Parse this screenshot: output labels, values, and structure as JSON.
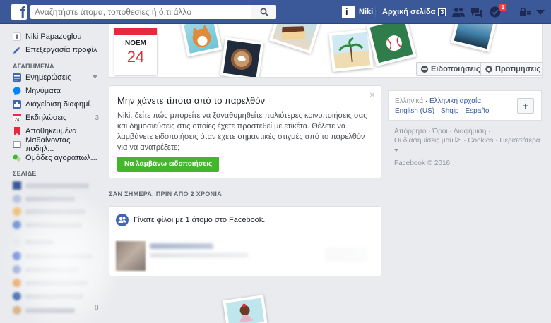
{
  "topbar": {
    "logo_letter": "f",
    "search_placeholder": "Αναζητήστε άτομα, τοποθεσίες ή ό,τι άλλο",
    "user_name": "Niki",
    "user_avatar_letter": "i",
    "home_label": "Αρχική σελίδα",
    "home_count": "3",
    "notification_badge": "1",
    "icons": [
      "friend-requests-icon",
      "messages-icon",
      "notifications-icon",
      "privacy-lock-icon",
      "account-menu-icon"
    ]
  },
  "sidebar": {
    "profile_name": "Niki Papazoglou",
    "edit_profile": "Επεξεργασία προφίλ",
    "favorites_title": "ΑΓΑΠΗΜΕΝΑ",
    "items": [
      {
        "label": "Ενημερώσεις",
        "icon": "news-feed-icon",
        "count": ""
      },
      {
        "label": "Μηνύματα",
        "icon": "messages-icon",
        "count": ""
      },
      {
        "label": "Διαχείριση διαφημί...",
        "icon": "ads-manager-icon",
        "count": ""
      },
      {
        "label": "Εκδηλώσεις",
        "icon": "events-icon",
        "count": "3"
      },
      {
        "label": "Αποθηκευμένα",
        "icon": "saved-icon",
        "count": ""
      },
      {
        "label": "Μαθαίνοντας ποδηλ...",
        "icon": "book-icon",
        "count": ""
      },
      {
        "label": "Ομάδες αγοραπωλ...",
        "icon": "groups-icon",
        "count": ""
      }
    ],
    "pages_title": "ΣΕΛΙΔΕ",
    "last_count": "8"
  },
  "hero": {
    "calendar_month": "ΝΟΕΜ",
    "calendar_day": "24",
    "notifications_button": "Ειδοποιήσεις",
    "preferences_button": "Προτιμήσεις"
  },
  "promo": {
    "title": "Μην χάνετε τίποτα από το παρελθόν",
    "body": "Niki, δείτε πώς μπορείτε να ξαναθυμηθείτε παλιότερες κοινοποιήσεις σας και δημοσιεύσεις στις οποίες έχετε προστεθεί με ετικέτα. Θέλετε να λαμβάνετε ειδοποιήσεις όταν έχετε σημαντικές στιγμές από το παρελθόν για να ανατρέξετε;",
    "button": "Να λαμβάνω ειδοποιήσεις",
    "close": "×"
  },
  "memories": {
    "section_title": "ΣΑΝ ΣΗΜΕΡΑ, ΠΡΙΝ ΑΠΟ 2 ΧΡΟΝΙΑ",
    "card_title": "Γίνατε φίλοι με 1 άτομο στο Facebook."
  },
  "right": {
    "current_language": "Ελληνικά",
    "languages": [
      "Ελληνική αρχαία",
      "English (US)",
      "Shqip",
      "Español"
    ],
    "footer_links": [
      "Απόρρητο",
      "Όροι",
      "Διαφήμιση",
      "Οι διαφημίσεις μου",
      "Cookies",
      "Περισσότερα"
    ],
    "copyright": "Facebook © 2016"
  },
  "colors": {
    "brand": "#3b5998",
    "green": "#42b72a",
    "badge": "#fa3e3e",
    "calendar_red": "#e9273d"
  }
}
